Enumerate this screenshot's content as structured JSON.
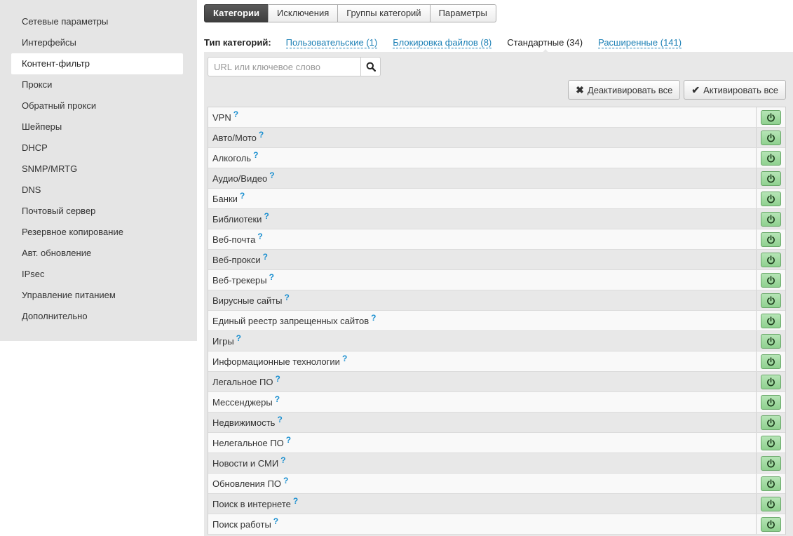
{
  "sidebar": {
    "items": [
      {
        "label": "Сетевые параметры"
      },
      {
        "label": "Интерфейсы"
      },
      {
        "label": "Контент-фильтр",
        "active": true
      },
      {
        "label": "Прокси"
      },
      {
        "label": "Обратный прокси"
      },
      {
        "label": "Шейперы"
      },
      {
        "label": "DHCP"
      },
      {
        "label": "SNMP/MRTG"
      },
      {
        "label": "DNS"
      },
      {
        "label": "Почтовый сервер"
      },
      {
        "label": "Резервное копирование"
      },
      {
        "label": "Авт. обновление"
      },
      {
        "label": "IPsec"
      },
      {
        "label": "Управление питанием"
      },
      {
        "label": "Дополнительно"
      }
    ]
  },
  "tabs": [
    {
      "label": "Категории",
      "active": true
    },
    {
      "label": "Исключения"
    },
    {
      "label": "Группы категорий"
    },
    {
      "label": "Параметры"
    }
  ],
  "category_types": {
    "label": "Тип категорий:",
    "items": [
      {
        "label": "Пользовательские (1)",
        "current": false
      },
      {
        "label": "Блокировка файлов (8)",
        "current": false
      },
      {
        "label": "Стандартные (34)",
        "current": true
      },
      {
        "label": "Расширенные (141)",
        "current": false
      }
    ]
  },
  "search": {
    "placeholder": "URL или ключевое слово",
    "value": ""
  },
  "actions": {
    "deactivate_all": "Деактивировать все",
    "activate_all": "Активировать все"
  },
  "help_mark": "?",
  "categories": [
    "VPN",
    "Авто/Мото",
    "Алкоголь",
    "Аудио/Видео",
    "Банки",
    "Библиотеки",
    "Веб-почта",
    "Веб-прокси",
    "Веб-трекеры",
    "Вирусные сайты",
    "Единый реестр запрещенных сайтов",
    "Игры",
    "Информационные технологии",
    "Легальное ПО",
    "Мессенджеры",
    "Недвижимость",
    "Нелегальное ПО",
    "Новости и СМИ",
    "Обновления ПО",
    "Поиск в интернете",
    "Поиск работы"
  ],
  "colors": {
    "accent_link": "#1a7fb5",
    "power_on": "#8fd08f",
    "active_tab": "#3e3e3e"
  }
}
